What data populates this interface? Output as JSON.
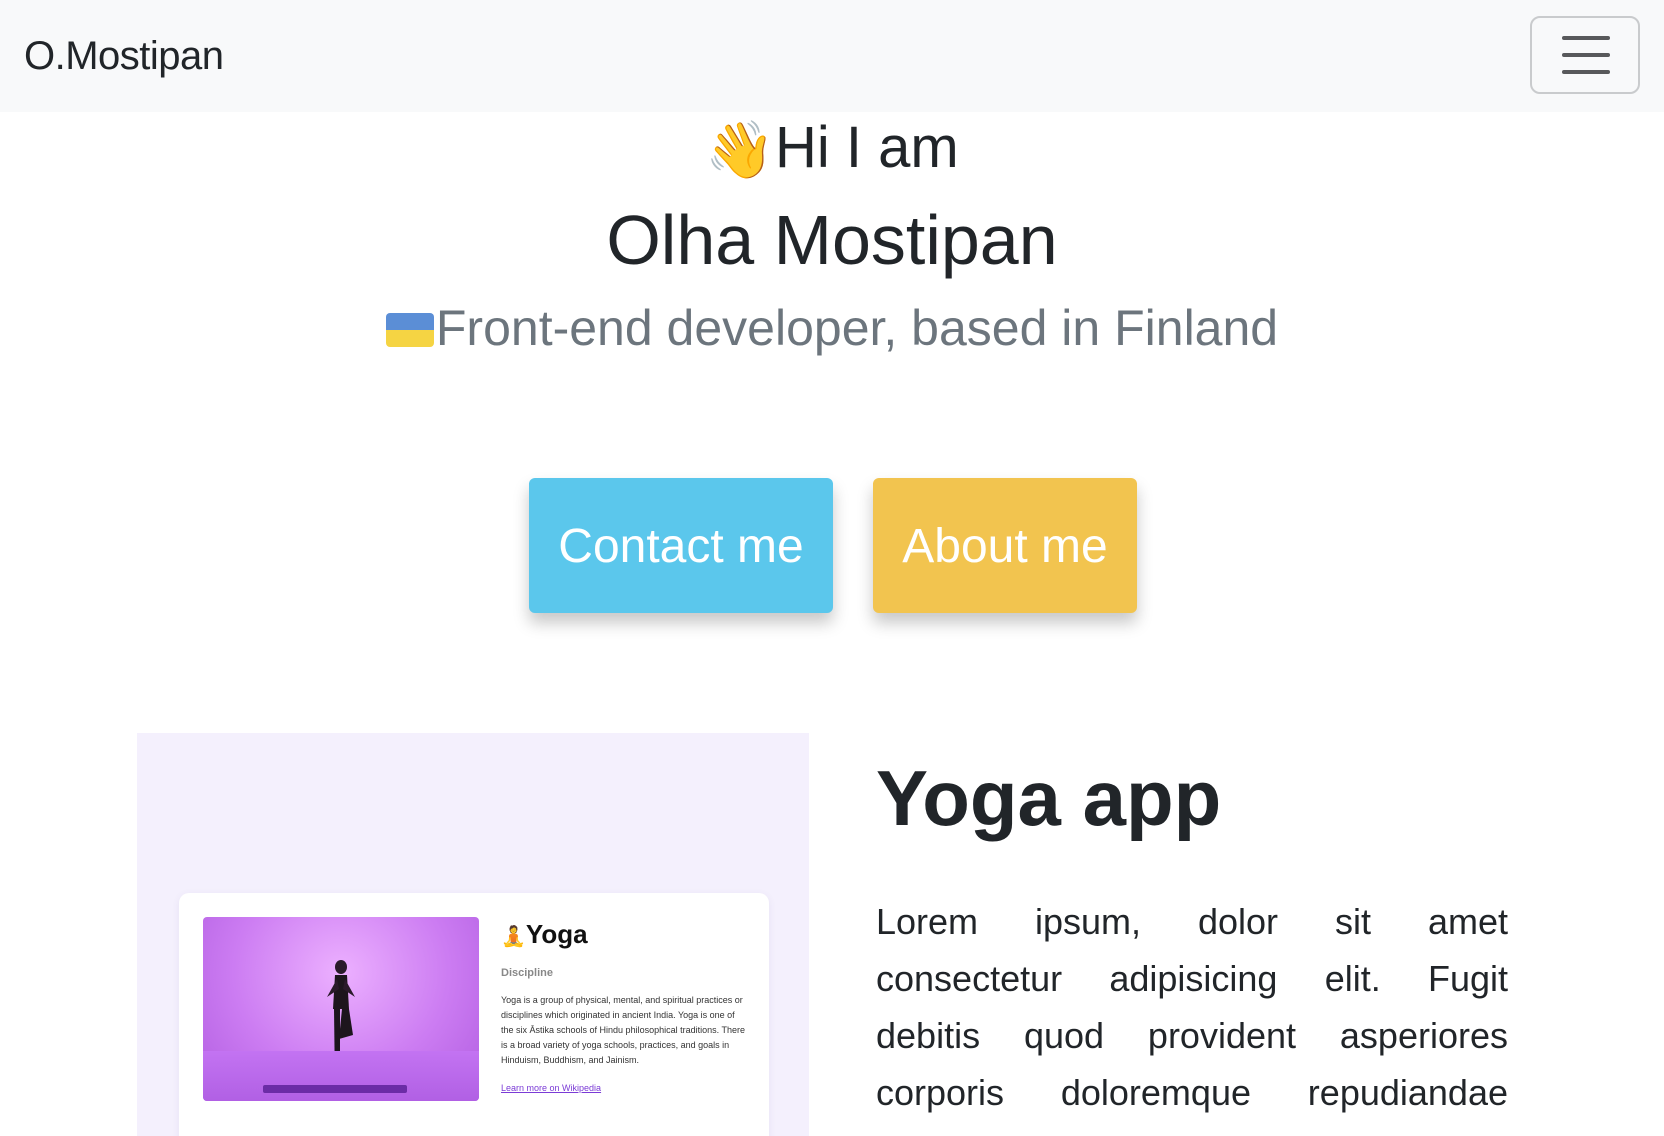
{
  "navbar": {
    "brand": "O.Mostipan",
    "menu_icon": "hamburger-menu-icon"
  },
  "hero": {
    "wave_icon": "waving-hand-icon",
    "wave_glyph": "👋",
    "greeting": "Hi I am",
    "name": "Olha Mostipan",
    "flag_icon": "ukraine-flag-icon",
    "role": "Front-end developer, based in Finland"
  },
  "buttons": {
    "contact": "Contact me",
    "about": "About me"
  },
  "colors": {
    "contact_button": "#5bc7ec",
    "about_button": "#f2c44f",
    "navbar_bg": "#f8f9fa",
    "subtitle": "#6c757d",
    "project_bg": "#f4f0fd"
  },
  "project": {
    "title": "Yoga app",
    "description": "Lorem ipsum, dolor sit amet consectetur adipisicing elit. Fugit debitis quod provident asperiores corporis doloremque repudiandae",
    "preview": {
      "icon": "lotus-position-icon",
      "icon_glyph": "🧘",
      "title": "Yoga",
      "subtitle": "Discipline",
      "text": "Yoga is a group of physical, mental, and spiritual practices or disciplines which originated in ancient India. Yoga is one of the six Āstika schools of Hindu philosophical traditions. There is a broad variety of yoga schools, practices, and goals in Hinduism, Buddhism, and Jainism.",
      "link": "Learn more on Wikipedia"
    }
  }
}
